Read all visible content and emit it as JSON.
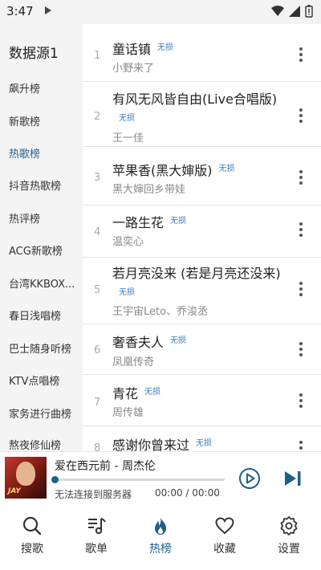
{
  "status_bar": {
    "time": "3:47"
  },
  "sidebar": {
    "source_title": "数据源1",
    "items": [
      {
        "label": "飙升榜",
        "active": false
      },
      {
        "label": "新歌榜",
        "active": false
      },
      {
        "label": "热歌榜",
        "active": true
      },
      {
        "label": "抖音热歌榜",
        "active": false
      },
      {
        "label": "热评榜",
        "active": false
      },
      {
        "label": "ACG新歌榜",
        "active": false
      },
      {
        "label": "台湾KKBOX...",
        "active": false
      },
      {
        "label": "春日浅唱榜",
        "active": false
      },
      {
        "label": "巴士随身听榜",
        "active": false
      },
      {
        "label": "KTV点唱榜",
        "active": false
      },
      {
        "label": "家务进行曲榜",
        "active": false
      },
      {
        "label": "熬夜修仙榜",
        "active": false
      }
    ]
  },
  "songs": [
    {
      "index": "1",
      "title": "童话镇",
      "tag": "无损",
      "artist": "小野来了"
    },
    {
      "index": "2",
      "title": "有风无风皆自由(Live合唱版)",
      "tag": "无损",
      "artist": "王一佳"
    },
    {
      "index": "3",
      "title": "苹果香(黑大婶版)",
      "tag": "无损",
      "artist": "黑大婶回乡带娃"
    },
    {
      "index": "4",
      "title": "一路生花",
      "tag": "无损",
      "artist": "温奕心"
    },
    {
      "index": "5",
      "title": "若月亮没来 (若是月亮还没来)",
      "tag": "无损",
      "artist": "王宇宙Leto、乔浚丞"
    },
    {
      "index": "6",
      "title": "奢香夫人",
      "tag": "无损",
      "artist": "凤凰传奇"
    },
    {
      "index": "7",
      "title": "青花",
      "tag": "无损",
      "artist": "周传雄"
    },
    {
      "index": "8",
      "title": "感谢你曾来过",
      "tag": "无损",
      "artist": ""
    }
  ],
  "player": {
    "cover_text": "JAY",
    "now_playing": "爱在西元前 - 周杰伦",
    "status": "无法连接到服务器",
    "time": "00:00 / 00:00",
    "progress": 0
  },
  "nav": [
    {
      "label": "搜歌",
      "icon": "search-icon",
      "active": false
    },
    {
      "label": "歌单",
      "icon": "music-list-icon",
      "active": false
    },
    {
      "label": "热榜",
      "icon": "flame-icon",
      "active": true
    },
    {
      "label": "收藏",
      "icon": "heart-icon",
      "active": false
    },
    {
      "label": "设置",
      "icon": "gear-icon",
      "active": false
    }
  ],
  "colors": {
    "accent": "#1f5f8b",
    "tag": "#3a7bbd",
    "sidebar_bg": "#f4f4f4"
  }
}
